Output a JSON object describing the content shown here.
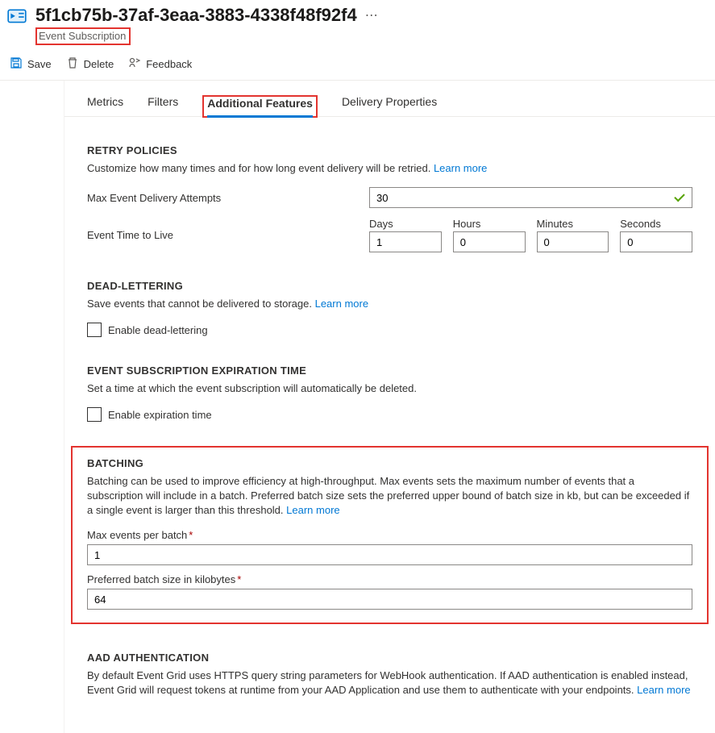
{
  "header": {
    "title": "5f1cb75b-37af-3eaa-3883-4338f48f92f4",
    "subtitle": "Event Subscription"
  },
  "toolbar": {
    "save": "Save",
    "delete": "Delete",
    "feedback": "Feedback"
  },
  "tabs": {
    "metrics": "Metrics",
    "filters": "Filters",
    "additional": "Additional Features",
    "delivery": "Delivery Properties"
  },
  "retry": {
    "title": "RETRY POLICIES",
    "desc": "Customize how many times and for how long event delivery will be retried.",
    "learn": "Learn more",
    "maxAttemptsLabel": "Max Event Delivery Attempts",
    "maxAttemptsValue": "30",
    "ttlLabel": "Event Time to Live",
    "days": {
      "label": "Days",
      "value": "1"
    },
    "hours": {
      "label": "Hours",
      "value": "0"
    },
    "minutes": {
      "label": "Minutes",
      "value": "0"
    },
    "seconds": {
      "label": "Seconds",
      "value": "0"
    }
  },
  "dead": {
    "title": "DEAD-LETTERING",
    "desc": "Save events that cannot be delivered to storage.",
    "learn": "Learn more",
    "enable": "Enable dead-lettering"
  },
  "expire": {
    "title": "EVENT SUBSCRIPTION EXPIRATION TIME",
    "desc": "Set a time at which the event subscription will automatically be deleted.",
    "enable": "Enable expiration time"
  },
  "batch": {
    "title": "BATCHING",
    "desc": "Batching can be used to improve efficiency at high-throughput. Max events sets the maximum number of events that a subscription will include in a batch. Preferred batch size sets the preferred upper bound of batch size in kb, but can be exceeded if a single event is larger than this threshold.",
    "learn": "Learn more",
    "maxEventsLabel": "Max events per batch",
    "maxEventsValue": "1",
    "prefSizeLabel": "Preferred batch size in kilobytes",
    "prefSizeValue": "64"
  },
  "aad": {
    "title": "AAD AUTHENTICATION",
    "desc": "By default Event Grid uses HTTPS query string parameters for WebHook authentication. If AAD authentication is enabled instead, Event Grid will request tokens at runtime from your AAD Application and use them to authenticate with your endpoints.",
    "learn": "Learn more"
  }
}
